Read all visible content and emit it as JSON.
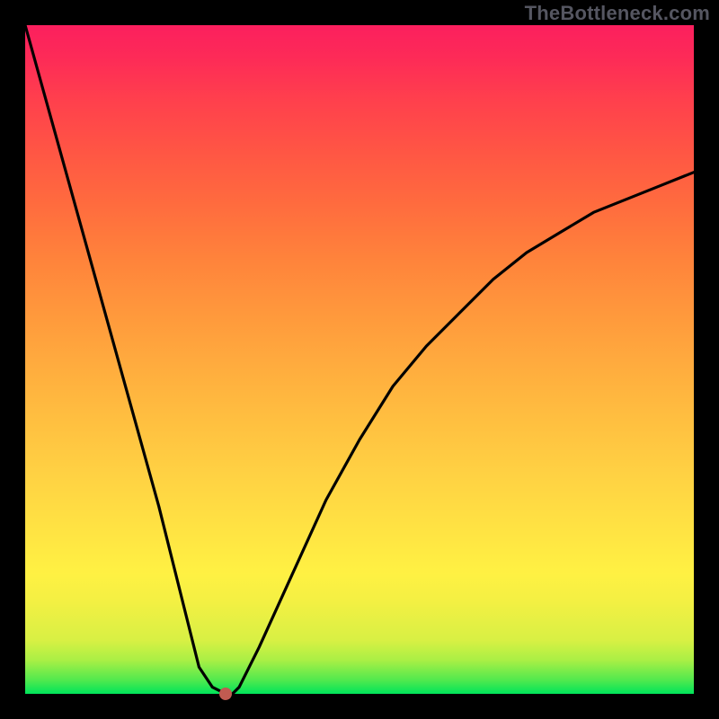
{
  "attribution": "TheBottleneck.com",
  "chart_data": {
    "type": "line",
    "title": "",
    "xlabel": "",
    "ylabel": "",
    "xlim": [
      0,
      100
    ],
    "ylim": [
      0,
      100
    ],
    "grid": false,
    "legend": false,
    "background_gradient": {
      "bottom": "#00e45a",
      "mid_low": "#fff143",
      "mid_high": "#ff983c",
      "top": "#fb1f5e"
    },
    "series": [
      {
        "name": "curve",
        "color": "#000000",
        "x": [
          0,
          5,
          10,
          15,
          20,
          24,
          26,
          28,
          30,
          31,
          32,
          35,
          40,
          45,
          50,
          55,
          60,
          65,
          70,
          75,
          80,
          85,
          90,
          95,
          100
        ],
        "y": [
          100,
          82,
          64,
          46,
          28,
          12,
          4,
          1,
          0,
          0,
          1,
          7,
          18,
          29,
          38,
          46,
          52,
          57,
          62,
          66,
          69,
          72,
          74,
          76,
          78
        ]
      }
    ],
    "marker": {
      "x": 30,
      "y": 0,
      "color": "#c15b51"
    }
  }
}
